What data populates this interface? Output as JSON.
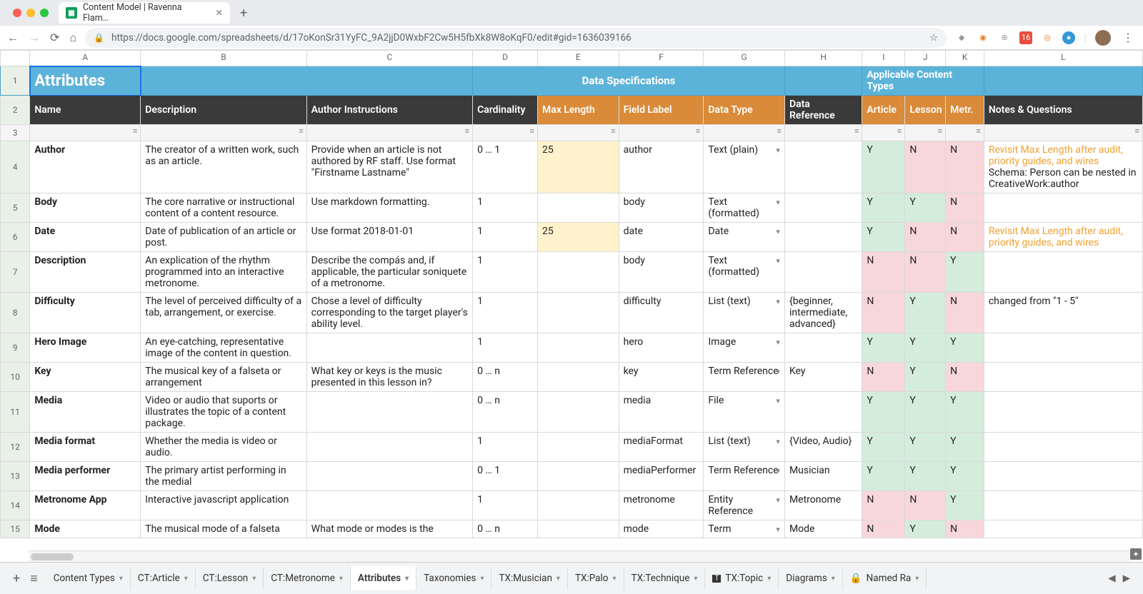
{
  "browser": {
    "tab_title": "Content Model | Ravenna Flam…",
    "url": "https://docs.google.com/spreadsheets/d/17oKonSr31YyFC_9A2jjD0WxbF2Cw5H5fbXk8W8oKqF0/edit#gid=1636039166"
  },
  "col_letters": [
    "A",
    "B",
    "C",
    "D",
    "E",
    "F",
    "G",
    "H",
    "I",
    "J",
    "K",
    "L"
  ],
  "banner": {
    "title": "Attributes",
    "spec": "Data Specifications",
    "types": "Applicable Content Types"
  },
  "headers": {
    "name": "Name",
    "description": "Description",
    "instructions": "Author Instructions",
    "cardinality": "Cardinality",
    "maxlen": "Max Length",
    "fieldlabel": "Field Label",
    "datatype": "Data Type",
    "dataref": "Data Reference",
    "article": "Article",
    "lesson": "Lesson",
    "metr": "Metr.",
    "notes": "Notes & Questions"
  },
  "rows": [
    {
      "n": "4",
      "name": "Author",
      "desc": "The creator of a written work, such as an article.",
      "instr": "Provide when an article is not authored by RF staff. Use format \"Firstname Lastname\"",
      "card": "0 … 1",
      "maxlen": "25",
      "ml_hl": true,
      "field": "author",
      "dtype": "Text (plain)",
      "dref": "",
      "a": "Y",
      "l": "N",
      "m": "N",
      "notes": [
        "Revisit Max Length after audit, priority guides, and wires",
        "Schema: Person can be nested in CreativeWork:author"
      ],
      "notes_hl": [
        true,
        false
      ]
    },
    {
      "n": "5",
      "name": "Body",
      "desc": "The core narrative or instructional content of a content resource.",
      "instr": "Use markdown formatting.",
      "card": "1",
      "maxlen": "",
      "field": "body",
      "dtype": "Text (formatted)",
      "dref": "",
      "a": "Y",
      "l": "Y",
      "m": "N",
      "notes": []
    },
    {
      "n": "6",
      "name": "Date",
      "desc": "Date of publication of an article or post.",
      "instr": "Use format 2018-01-01",
      "card": "1",
      "maxlen": "25",
      "ml_hl": true,
      "field": "date",
      "dtype": "Date",
      "dref": "",
      "a": "Y",
      "l": "N",
      "m": "N",
      "notes": [
        "Revisit Max Length after audit, priority guides, and wires"
      ],
      "notes_hl": [
        true
      ]
    },
    {
      "n": "7",
      "name": "Description",
      "desc": "An explication of the rhythm programmed into an interactive metronome.",
      "instr": "Describe the compás and, if applicable, the particular soniquete of a metronome.",
      "card": "1",
      "maxlen": "",
      "field": "body",
      "dtype": "Text (formatted)",
      "dref": "",
      "a": "N",
      "l": "N",
      "m": "Y",
      "notes": []
    },
    {
      "n": "8",
      "name": "Difficulty",
      "desc": "The level of perceived difficulty of a tab, arrangement, or exercise.",
      "instr": "Chose a level of difficulty corresponding to the target player's ability level.",
      "card": "1",
      "maxlen": "",
      "field": "difficulty",
      "dtype": "List (text)",
      "dref": "{beginner, intermediate, advanced}",
      "a": "N",
      "l": "Y",
      "m": "N",
      "notes": [
        "changed from \"1 - 5\""
      ],
      "notes_hl": [
        false
      ]
    },
    {
      "n": "9",
      "name": "Hero Image",
      "desc": "An eye-catching, representative image of the content in question.",
      "instr": "",
      "card": "1",
      "maxlen": "",
      "field": "hero",
      "dtype": "Image",
      "dref": "",
      "a": "Y",
      "l": "Y",
      "m": "Y",
      "notes": []
    },
    {
      "n": "10",
      "name": "Key",
      "desc": "The musical key of a falseta or arrangement",
      "instr": "What key or keys is the music presented in this lesson in?",
      "card": "0 … n",
      "maxlen": "",
      "field": "key",
      "dtype": "Term Reference",
      "dref": "Key",
      "a": "N",
      "l": "Y",
      "m": "N",
      "notes": []
    },
    {
      "n": "11",
      "name": "Media",
      "desc": "Video or audio that suports or illustrates the topic of a content package.",
      "instr": "",
      "card": "0 … n",
      "maxlen": "",
      "field": "media",
      "dtype": "File",
      "dref": "",
      "a": "Y",
      "l": "Y",
      "m": "Y",
      "notes": []
    },
    {
      "n": "12",
      "name": "Media format",
      "desc": "Whether the media is video or audio.",
      "instr": "",
      "card": "1",
      "maxlen": "",
      "field": "mediaFormat",
      "dtype": "List (text)",
      "dref": "{Video, Audio}",
      "a": "Y",
      "l": "Y",
      "m": "Y",
      "notes": []
    },
    {
      "n": "13",
      "name": "Media performer",
      "desc": "The primary artist performing in the medial",
      "instr": "",
      "card": "0 … 1",
      "maxlen": "",
      "field": "mediaPerformer",
      "dtype": "Term Reference",
      "dref": "Musician",
      "a": "Y",
      "l": "Y",
      "m": "Y",
      "notes": []
    },
    {
      "n": "14",
      "name": "Metronome App",
      "desc": "Interactive javascript application",
      "instr": "",
      "card": "1",
      "maxlen": "",
      "field": "metronome",
      "dtype": "Entity Reference",
      "dref": "Metronome",
      "a": "N",
      "l": "N",
      "m": "Y",
      "notes": []
    },
    {
      "n": "15",
      "name": "Mode",
      "desc": "The musical mode of a falseta",
      "instr": "What mode or modes is the",
      "card": "0 … n",
      "maxlen": "",
      "field": "mode",
      "dtype": "Term",
      "dref": "Mode",
      "a": "N",
      "l": "Y",
      "m": "N",
      "notes": [],
      "cut": true
    }
  ],
  "sheet_tabs": [
    "Content Types",
    "CT:Article",
    "CT:Lesson",
    "CT:Metronome",
    "Attributes",
    "Taxonomies",
    "TX:Musician",
    "TX:Palo",
    "TX:Technique",
    "TX:Topic",
    "Diagrams",
    "Named Ra"
  ],
  "active_tab": "Attributes",
  "locked_tab": "Named Ra"
}
